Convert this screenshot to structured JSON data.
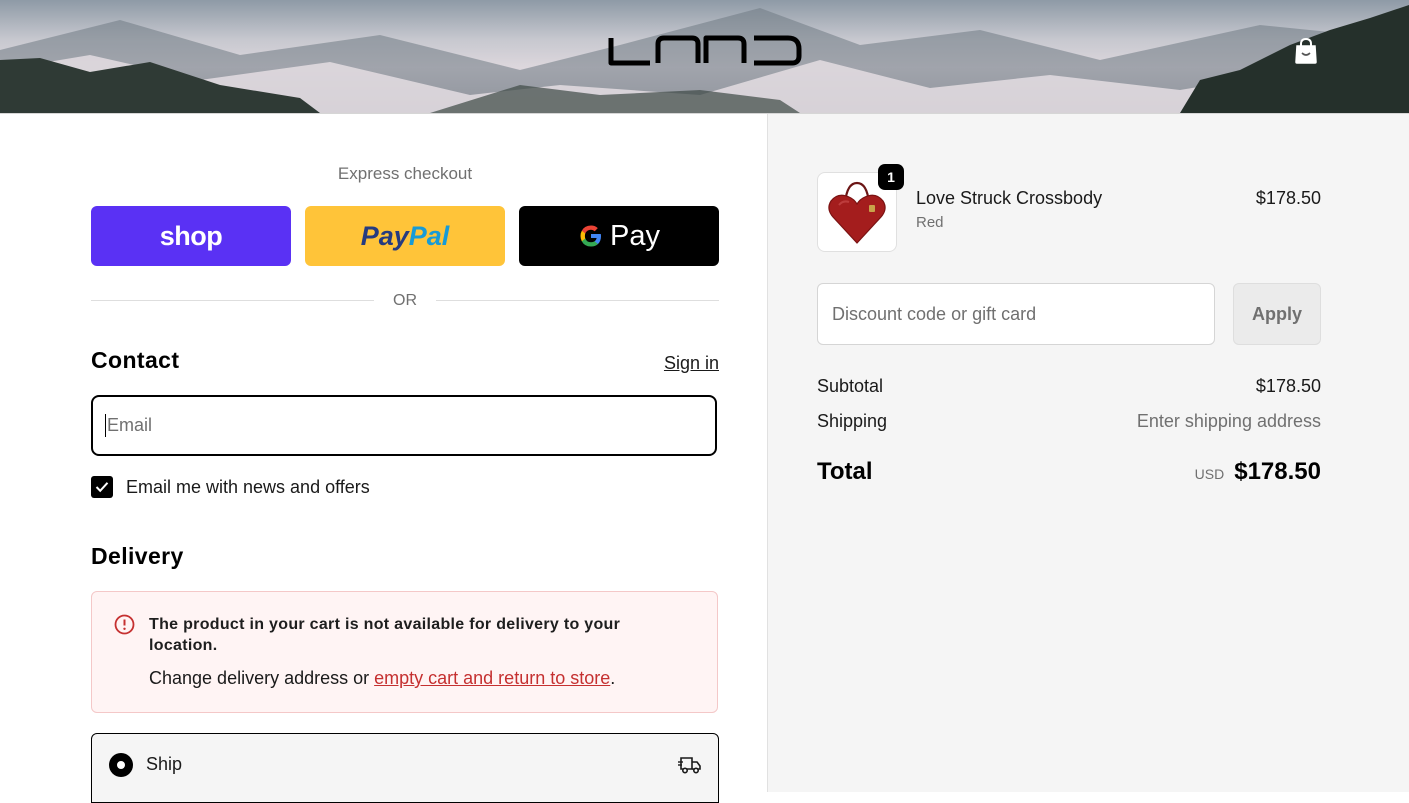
{
  "header": {
    "logo_text": "LAND",
    "cart_icon": "shopping-bag-icon"
  },
  "express": {
    "title": "Express checkout",
    "shop_label": "shop",
    "paypal_part1": "Pay",
    "paypal_part2": "Pal",
    "gpay_label": "Pay",
    "or_label": "OR"
  },
  "contact": {
    "heading": "Contact",
    "signin_label": "Sign in",
    "email_placeholder": "Email",
    "newsletter_label": "Email me with news and offers",
    "newsletter_checked": true
  },
  "delivery": {
    "heading": "Delivery",
    "notice_title": "The product in your cart is not available for delivery to your location.",
    "notice_prefix": "Change delivery address or ",
    "notice_link": "empty cart and return to store",
    "notice_suffix": ".",
    "ship_label": "Ship",
    "ship_icon": "delivery-truck-icon"
  },
  "summary": {
    "product": {
      "name": "Love Struck Crossbody",
      "variant": "Red",
      "price": "$178.50",
      "quantity": "1"
    },
    "discount_placeholder": "Discount code or gift card",
    "apply_label": "Apply",
    "subtotal_label": "Subtotal",
    "subtotal_value": "$178.50",
    "shipping_label": "Shipping",
    "shipping_value": "Enter shipping address",
    "total_label": "Total",
    "total_currency": "USD",
    "total_value": "$178.50"
  },
  "colors": {
    "shop_pay": "#5a31f4",
    "paypal": "#ffc439",
    "gpay": "#000000",
    "error_bg": "#fff4f4",
    "error_accent": "#c53030",
    "summary_bg": "#f5f5f5"
  }
}
